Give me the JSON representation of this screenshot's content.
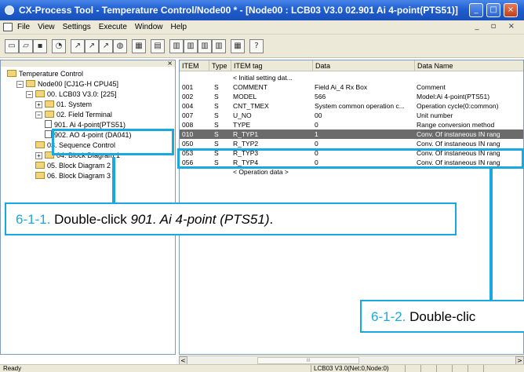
{
  "window": {
    "title": "CX-Process Tool - Temperature Control/Node00 * - [Node00 : LCB03 V3.0 02.901 Ai 4-point(PTS51)]",
    "buttons": {
      "minimize": "_",
      "maximize": "□",
      "close": "×"
    }
  },
  "menubar": {
    "items": [
      "File",
      "View",
      "Settings",
      "Execute",
      "Window",
      "Help"
    ],
    "mdi_controls": "_ ▫ ×"
  },
  "toolbar": {
    "icons": [
      "new-icon",
      "open-icon",
      "save-icon",
      "print-icon",
      "wire-icon",
      "wire2-icon",
      "wire3-icon",
      "info-icon",
      "block-icon",
      "grid-icon",
      "table-icon",
      "table2-icon",
      "table3-icon",
      "table4-icon",
      "list-icon",
      "help-icon"
    ]
  },
  "tree": {
    "close_glyph": "×",
    "items": [
      {
        "label": "Temperature Control",
        "indent": 0,
        "icon": "folder",
        "expander": ""
      },
      {
        "label": "Node00 [CJ1G-H CPU45]",
        "indent": 1,
        "icon": "folder",
        "expander": "−"
      },
      {
        "label": "00. LCB03 V3.0: [225]",
        "indent": 2,
        "icon": "folder",
        "expander": "−"
      },
      {
        "label": "01. System",
        "indent": 3,
        "icon": "folder",
        "expander": "+"
      },
      {
        "label": "02. Field Terminal",
        "indent": 3,
        "icon": "folder",
        "expander": "−"
      },
      {
        "label": "901. Ai 4-point(PTS51)",
        "indent": 4,
        "icon": "doc",
        "expander": ""
      },
      {
        "label": "902. AO 4-point (DA041)",
        "indent": 4,
        "icon": "doc",
        "expander": ""
      },
      {
        "label": "03. Sequence Control",
        "indent": 3,
        "icon": "folder",
        "expander": ""
      },
      {
        "label": "04. Block Diagram 1",
        "indent": 3,
        "icon": "folder",
        "expander": "+"
      },
      {
        "label": "05. Block Diagram 2",
        "indent": 3,
        "icon": "folder",
        "expander": ""
      },
      {
        "label": "06. Block Diagram 3",
        "indent": 3,
        "icon": "folder",
        "expander": ""
      }
    ]
  },
  "table": {
    "columns": [
      "ITEM",
      "Type",
      "ITEM tag",
      "Data",
      "Data Name"
    ],
    "rows": [
      {
        "item": "",
        "type": "",
        "tag": "< Initial setting dat...",
        "data": "",
        "name": "",
        "selected": false
      },
      {
        "item": "001",
        "type": "S",
        "tag": "COMMENT",
        "data": "Field Ai_4 Rx Box",
        "name": "Comment",
        "selected": false
      },
      {
        "item": "002",
        "type": "S",
        "tag": "MODEL",
        "data": "566",
        "name": "Model:Ai 4-point(PTS51)",
        "selected": false
      },
      {
        "item": "004",
        "type": "S",
        "tag": "CNT_TMEX",
        "data": "System common operation c...",
        "name": "Operation cycle(0:common)",
        "selected": false
      },
      {
        "item": "007",
        "type": "S",
        "tag": "U_NO",
        "data": "00",
        "name": "Unit number",
        "selected": false
      },
      {
        "item": "008",
        "type": "S",
        "tag": "TYPE",
        "data": "0",
        "name": "Range conversion method",
        "selected": false
      },
      {
        "item": "010",
        "type": "S",
        "tag": "R_TYP1",
        "data": "1",
        "name": "Conv. Of instaneous IN rang",
        "selected": true
      },
      {
        "item": "050",
        "type": "S",
        "tag": "R_TYP2",
        "data": "0",
        "name": "Conv. Of instaneous IN rang",
        "selected": false
      },
      {
        "item": "053",
        "type": "S",
        "tag": "R_TYP3",
        "data": "0",
        "name": "Conv. Of instaneous IN rang",
        "selected": false
      },
      {
        "item": "056",
        "type": "S",
        "tag": "R_TYP4",
        "data": "0",
        "name": "Conv. Of instaneous IN rang",
        "selected": false
      },
      {
        "item": "",
        "type": "",
        "tag": "< Operation data >",
        "data": "",
        "name": "",
        "selected": false
      }
    ]
  },
  "scrollbar": {
    "left_arrow": "<",
    "right_arrow": ">",
    "thumb": "III"
  },
  "statusbar": {
    "left": "Ready",
    "middle": "LCB03 V3.0(Net:0,Node:0)"
  },
  "annotations": {
    "callout1": {
      "number": "6-1-1.",
      "text_before": "Double-click ",
      "italic": "901. Ai 4-point (PTS51)",
      "text_after": "."
    },
    "callout2": {
      "number": "6-1-2.",
      "text": "Double-clic"
    },
    "color": "#1aa8e0"
  }
}
